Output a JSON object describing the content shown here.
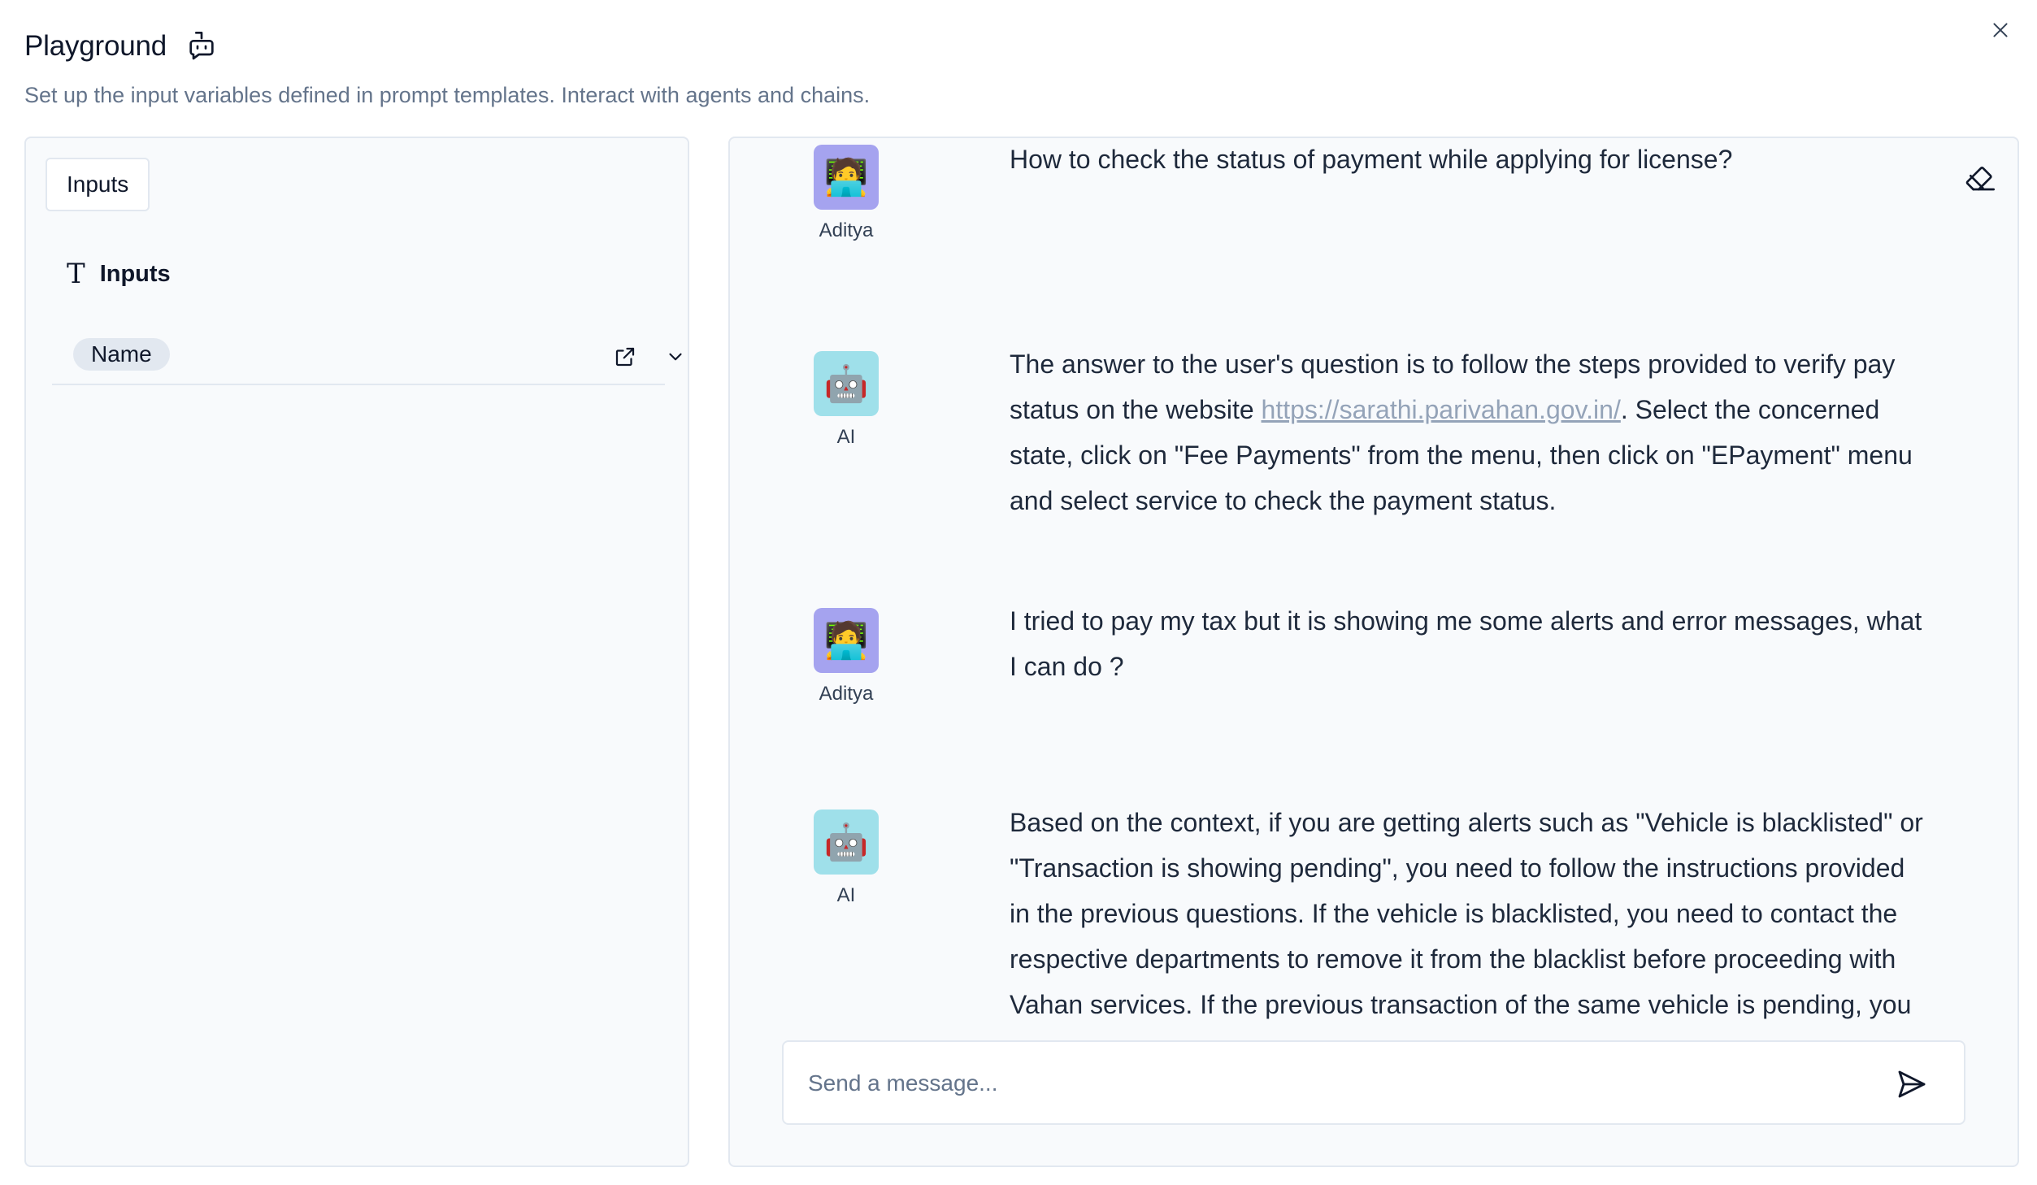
{
  "header": {
    "title": "Playground",
    "subtitle": "Set up the input variables defined in prompt templates. Interact with agents and chains."
  },
  "left_panel": {
    "tab_label": "Inputs",
    "section_label": "Inputs",
    "variables": [
      {
        "name": "Name"
      }
    ]
  },
  "chat": {
    "messages": [
      {
        "sender": "Aditya",
        "role": "user",
        "avatar_icon": "🧑‍💻",
        "text": "How to check the status of payment while applying for license?"
      },
      {
        "sender": "AI",
        "role": "ai",
        "avatar_icon": "🤖",
        "text_before_link": "The answer to the user's question is to follow the steps provided to verify pay status on the website ",
        "link": "https://sarathi.parivahan.gov.in/",
        "text_after_link": ". Select the concerned state, click on \"Fee Payments\" from the menu, then click on \"EPayment\" menu and select service to check the payment status."
      },
      {
        "sender": "Aditya",
        "role": "user",
        "avatar_icon": "🧑‍💻",
        "text": "I tried to pay my tax but it is showing me some alerts and error messages, what I can do ?"
      },
      {
        "sender": "AI",
        "role": "ai",
        "avatar_icon": "🤖",
        "text": "Based on the context, if you are getting alerts such as \"Vehicle is blacklisted\" or \"Transaction is showing pending\", you need to follow the instructions provided in the previous questions. If the vehicle is blacklisted, you need to contact the respective departments to remove it from the blacklist before proceeding with Vahan services. If the previous transaction of the same vehicle is pending, you"
      }
    ],
    "input_placeholder": "Send a message...",
    "input_value": ""
  },
  "colors": {
    "user_avatar_bg": "#a5a3ef",
    "ai_avatar_bg": "#9fe0ea",
    "panel_bg": "#f8fafc",
    "border": "#e2e8f0",
    "muted_text": "#64748b"
  },
  "icons": {
    "title": "bot-message-icon",
    "close": "close-icon",
    "section": "text-type-icon",
    "variable_open": "external-link-icon",
    "variable_expand": "chevron-down-icon",
    "clear_chat": "eraser-icon",
    "send": "send-icon"
  }
}
